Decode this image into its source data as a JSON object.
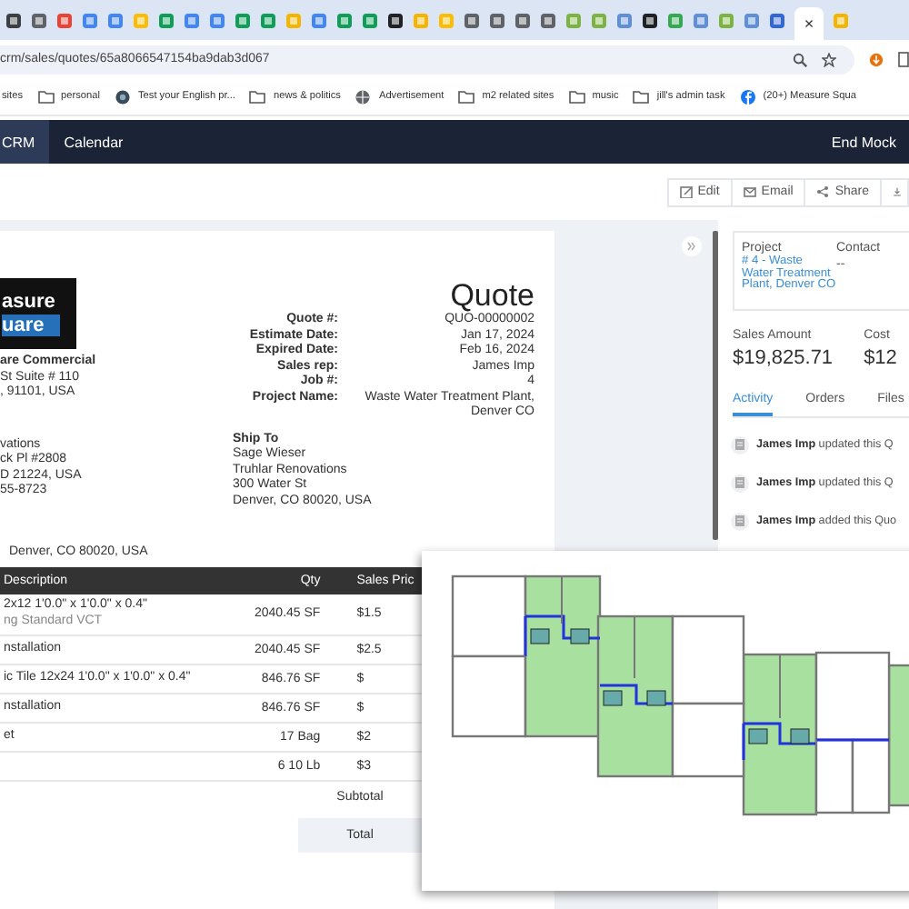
{
  "browser": {
    "tab_close": "×",
    "url": "crm/sales/quotes/65a8066547154ba9dab3d067",
    "bookmarks": [
      {
        "label": "sites",
        "kind": "plain"
      },
      {
        "label": "personal",
        "kind": "folder"
      },
      {
        "label": "Test your English pr...",
        "kind": "site"
      },
      {
        "label": "news & politics",
        "kind": "folder"
      },
      {
        "label": "Advertisement",
        "kind": "globe"
      },
      {
        "label": "m2 related sites",
        "kind": "folder"
      },
      {
        "label": "music",
        "kind": "folder"
      },
      {
        "label": "jill's admin task",
        "kind": "folder"
      },
      {
        "label": "(20+) Measure Squa",
        "kind": "facebook"
      }
    ]
  },
  "nav": {
    "items": [
      {
        "label": "CRM",
        "selected": true
      },
      {
        "label": "Calendar",
        "selected": false
      }
    ],
    "action": "End Mock"
  },
  "toolbar": [
    {
      "label": "Edit",
      "kind": "edit"
    },
    {
      "label": "Email",
      "kind": "mail"
    },
    {
      "label": "Share",
      "kind": "share"
    },
    {
      "kind": "download"
    }
  ],
  "quote": {
    "logo": [
      "asure",
      "uare"
    ],
    "company": [
      "are Commercial",
      "St Suite # 110",
      ", 91101, USA"
    ],
    "title": "Quote",
    "details": [
      {
        "label": "Quote #:",
        "value": "QUO-00000002"
      },
      {
        "label": "Estimate Date:",
        "value": "Jan 17, 2024"
      },
      {
        "label": "Expired Date:",
        "value": "Feb 16, 2024"
      },
      {
        "label": "Sales rep:",
        "value": "James Imp"
      },
      {
        "label": "Job #:",
        "value": "4"
      },
      {
        "label": "Project Name:",
        "value": "Waste Water Treatment Plant, Denver CO"
      }
    ],
    "bill_to": [
      "vations",
      "ck Pl #2808",
      "D 21224, USA",
      "55-8723"
    ],
    "ship_to": {
      "heading": "Ship To",
      "lines": [
        "Sage Wieser",
        "Truhlar Renovations",
        "300 Water St",
        "Denver, CO 80020, USA"
      ]
    },
    "location": "Denver, CO 80020, USA",
    "table": {
      "columns": [
        "Description",
        "Qty",
        "Sales Pric"
      ],
      "rows": [
        {
          "description": "2x12 1'0.0\" x 1'0.0\" x 0.4\"",
          "note": "ng Standard VCT",
          "qty": "2040.45 SF",
          "price": "$1.5"
        },
        {
          "description": "nstallation",
          "qty": "2040.45 SF",
          "price": "$2.5"
        },
        {
          "description": "ic Tile 12x24 1'0.0\" x 1'0.0\" x 0.4\"",
          "qty": "846.76 SF",
          "price": "$"
        },
        {
          "description": "nstallation",
          "qty": "846.76 SF",
          "price": "$"
        },
        {
          "description": "et",
          "qty": "17 Bag",
          "price": "$2"
        },
        {
          "qty": "6 10 Lb",
          "price": "$3"
        }
      ],
      "subtotal_label": "Subtotal",
      "total_label": "Total"
    }
  },
  "sidebar": {
    "project_label": "Project",
    "project_link": "# 4 - Waste Water Treatment Plant, Denver CO",
    "contact_label": "Contact",
    "contact_value": "--",
    "sales_label": "Sales Amount",
    "sales_value": "$19,825.71",
    "cost_label": "Cost",
    "cost_value": "$12",
    "tabs": [
      {
        "label": "Activity",
        "selected": true
      },
      {
        "label": "Orders",
        "selected": false
      },
      {
        "label": "Files",
        "selected": false
      }
    ],
    "activity": [
      "**James Imp** updated this Q",
      "**James Imp** updated this Q",
      "**James Imp** added this Quo"
    ]
  }
}
